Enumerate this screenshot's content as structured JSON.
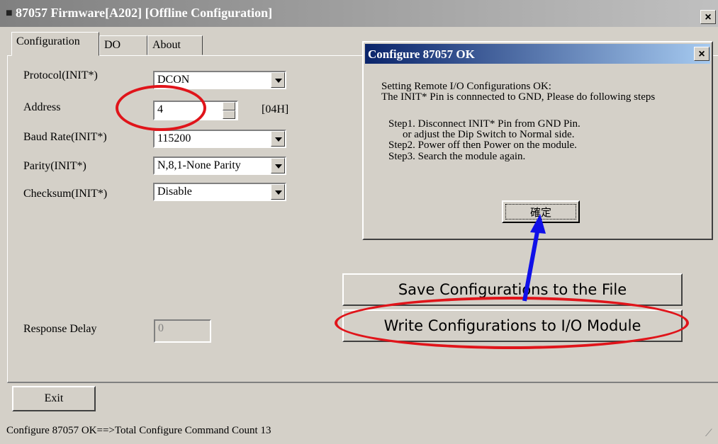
{
  "window": {
    "title": "87057 Firmware[A202] [Offline Configuration]",
    "close_label": "×"
  },
  "tabs": [
    {
      "label": "Configuration"
    },
    {
      "label": "DO"
    },
    {
      "label": "About"
    }
  ],
  "form": {
    "protocol": {
      "label": "Protocol(INIT*)",
      "value": "DCON"
    },
    "address": {
      "label": "Address",
      "value": "4",
      "hex": "[04H]"
    },
    "baud_rate": {
      "label": "Baud Rate(INIT*)",
      "value": "115200"
    },
    "parity": {
      "label": "Parity(INIT*)",
      "value": "N,8,1-None Parity"
    },
    "checksum": {
      "label": "Checksum(INIT*)",
      "value": "Disable"
    },
    "response_delay": {
      "label": "Response Delay",
      "value": "0"
    }
  },
  "buttons": {
    "save": "Save Configurations to the File",
    "write": "Write Configurations to I/O Module",
    "exit": "Exit"
  },
  "status_text": "Configure 87057 OK==>Total Configure Command Count 13",
  "dialog": {
    "title": "Configure 87057 OK",
    "close_label": "×",
    "lines": [
      "Setting Remote I/O Configurations OK:",
      "The INIT* Pin is connnected to GND, Please do following steps",
      "",
      "Step1. Disconnect INIT* Pin from GND Pin.",
      "or adjust the Dip Switch to Normal side.",
      "Step2. Power off then Power on the module.",
      "Step3. Search the module again."
    ],
    "ok_label": "確定"
  },
  "annotation_colors": {
    "ellipse": "#e0141a",
    "arrow": "#1010e8"
  }
}
